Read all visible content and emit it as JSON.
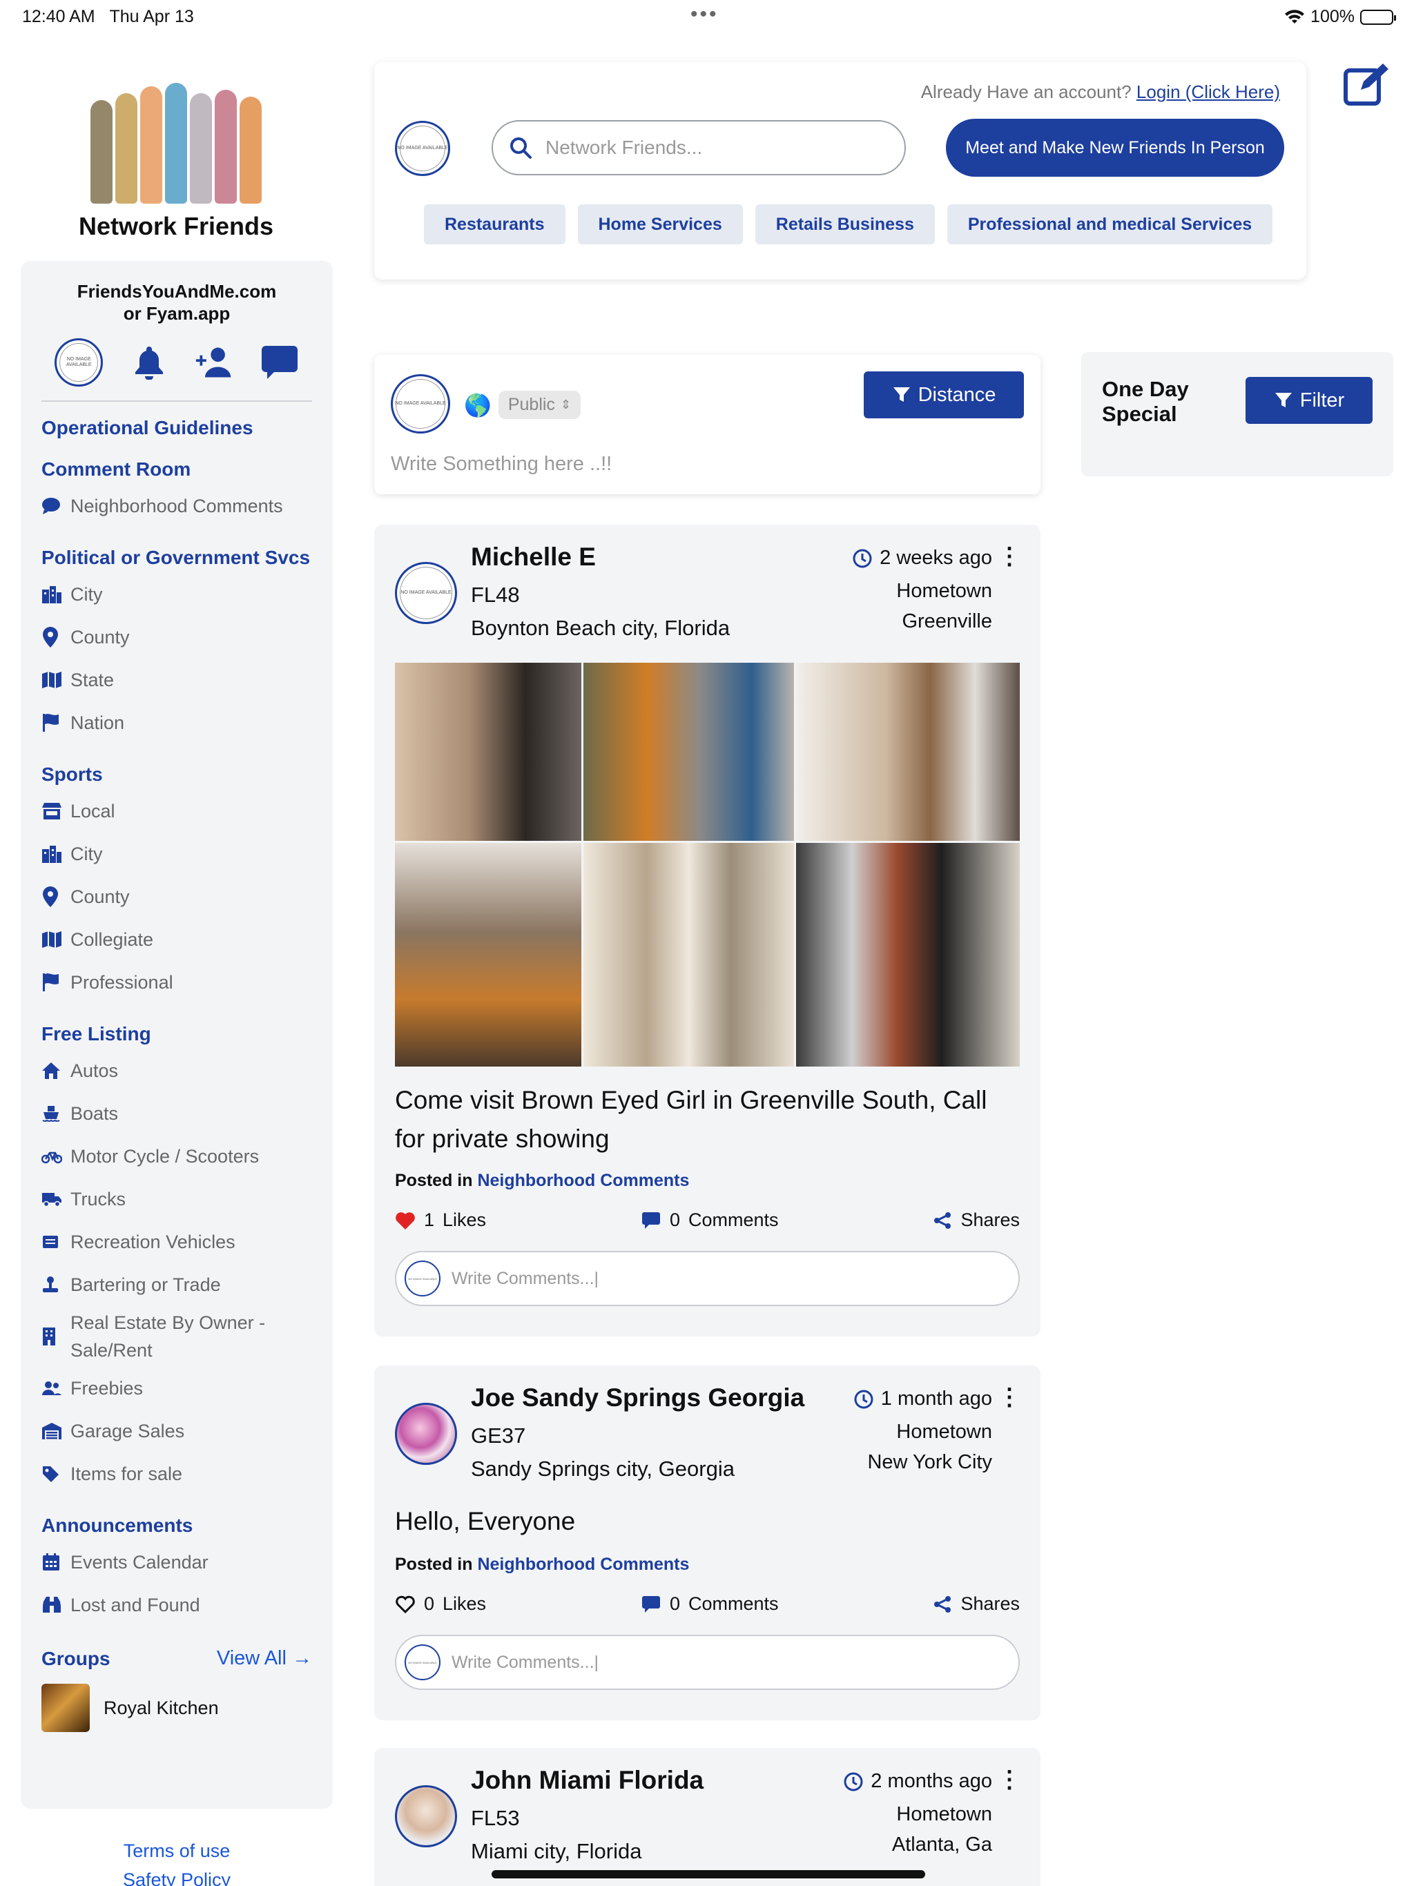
{
  "status": {
    "time": "12:40 AM",
    "date": "Thu Apr 13",
    "battery": "100%"
  },
  "brand": {
    "title": "Network Friends"
  },
  "sidebar": {
    "site_line1": "FriendsYouAndMe.com",
    "site_line2": "or Fyam.app",
    "avatar_text": "NO IMAGE AVAILABLE",
    "sections": [
      {
        "title": "Operational Guidelines",
        "items": []
      },
      {
        "title": "Comment Room",
        "items": [
          {
            "label": "Neighborhood Comments",
            "icon": "chat-bubble-icon"
          }
        ]
      },
      {
        "title": "Political or Government Svcs",
        "items": [
          {
            "label": "City",
            "icon": "city-icon"
          },
          {
            "label": "County",
            "icon": "location-pin-icon"
          },
          {
            "label": "State",
            "icon": "map-icon"
          },
          {
            "label": "Nation",
            "icon": "flag-icon"
          }
        ]
      },
      {
        "title": "Sports",
        "items": [
          {
            "label": "Local",
            "icon": "store-icon"
          },
          {
            "label": "City",
            "icon": "city-icon"
          },
          {
            "label": "County",
            "icon": "location-pin-icon"
          },
          {
            "label": "Collegiate",
            "icon": "map-icon"
          },
          {
            "label": "Professional",
            "icon": "flag-icon"
          }
        ]
      },
      {
        "title": "Free Listing",
        "items": [
          {
            "label": "Autos",
            "icon": "home-icon"
          },
          {
            "label": "Boats",
            "icon": "ship-icon"
          },
          {
            "label": "Motor Cycle / Scooters",
            "icon": "bicycle-icon"
          },
          {
            "label": "Trucks",
            "icon": "truck-icon"
          },
          {
            "label": "Recreation Vehicles",
            "icon": "rv-icon"
          },
          {
            "label": "Bartering or Trade",
            "icon": "trade-icon"
          },
          {
            "label": "Real Estate By Owner - Sale/Rent",
            "icon": "building-icon"
          },
          {
            "label": "Freebies",
            "icon": "users-icon"
          },
          {
            "label": "Garage Sales",
            "icon": "garage-icon"
          },
          {
            "label": "Items for sale",
            "icon": "tag-icon"
          }
        ]
      },
      {
        "title": "Announcements",
        "items": [
          {
            "label": "Events Calendar",
            "icon": "calendar-icon"
          },
          {
            "label": "Lost and Found",
            "icon": "binoculars-icon"
          }
        ]
      }
    ],
    "groups_title": "Groups",
    "view_all": "View All",
    "group_name": "Royal Kitchen"
  },
  "footer": {
    "terms": "Terms of use",
    "safety": "Safety Policy"
  },
  "header": {
    "already_text": "Already Have an account?",
    "login_link": "Login (Click Here)",
    "search_placeholder": "Network Friends...",
    "meet_button": "Meet and Make New Friends In Person",
    "categories": [
      "Restaurants",
      "Home Services",
      "Retails Business",
      "Professional and medical Services"
    ]
  },
  "composer": {
    "visibility": "Public",
    "distance_button": "Distance",
    "placeholder": "Write Something here ..!!"
  },
  "special": {
    "line1": "One Day",
    "line2": "Special",
    "filter_button": "Filter"
  },
  "posts": [
    {
      "name": "Michelle E",
      "code": "FL48",
      "location": "Boynton Beach city, Florida",
      "time": "2 weeks ago",
      "hometown_label": "Hometown",
      "hometown": "Greenville",
      "text": "Come visit Brown Eyed Girl in Greenville South, Call for private showing",
      "posted_prefix": "Posted in",
      "posted_in": "Neighborhood Comments",
      "likes": "1",
      "likes_label": "Likes",
      "comments": "0",
      "comments_label": "Comments",
      "shares_label": "Shares",
      "comment_placeholder": "Write Comments...|",
      "liked": true
    },
    {
      "name": "Joe Sandy Springs Georgia",
      "code": "GE37",
      "location": "Sandy Springs city, Georgia",
      "time": "1 month ago",
      "hometown_label": "Hometown",
      "hometown": "New York City",
      "text": "Hello, Everyone",
      "posted_prefix": "Posted in",
      "posted_in": "Neighborhood Comments",
      "likes": "0",
      "likes_label": "Likes",
      "comments": "0",
      "comments_label": "Comments",
      "shares_label": "Shares",
      "comment_placeholder": "Write Comments...|",
      "liked": false
    },
    {
      "name": "John Miami Florida",
      "code": "FL53",
      "location": "Miami city, Florida",
      "time": "2 months ago",
      "hometown_label": "Hometown",
      "hometown": "Atlanta, Ga"
    }
  ],
  "colors": {
    "primary": "#1d3f9e",
    "link": "#1a56db",
    "panel": "#f3f4f6",
    "like": "#e02424"
  }
}
